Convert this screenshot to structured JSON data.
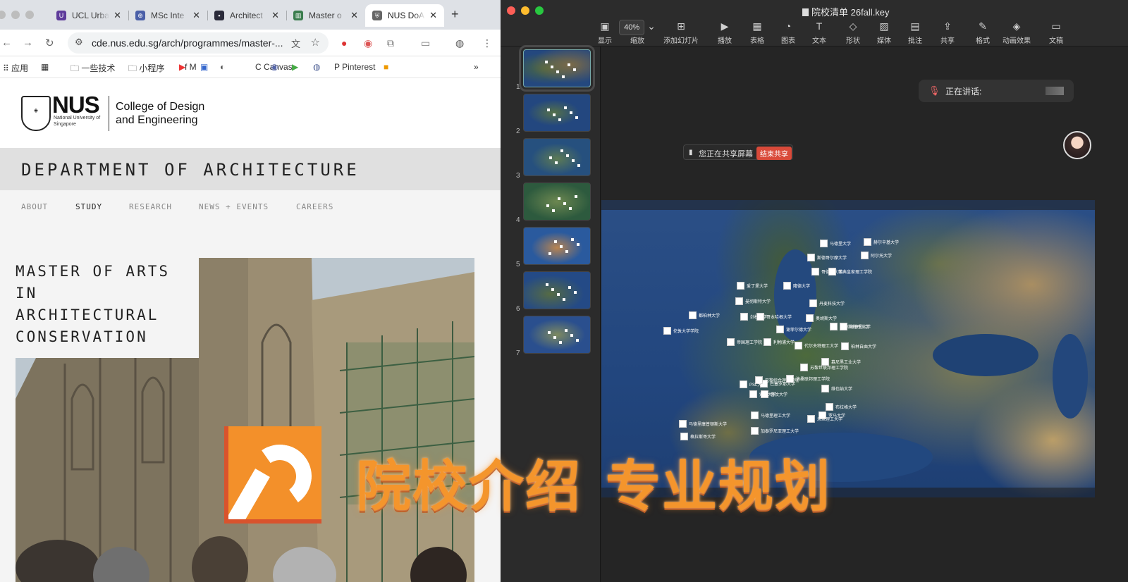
{
  "browser": {
    "tabs": [
      {
        "title": "UCL Urba",
        "color": "#5e3b9b",
        "glyph": "U"
      },
      {
        "title": "MSc Inte",
        "color": "#4a5fa8",
        "glyph": "⊕"
      },
      {
        "title": "Architect",
        "color": "#2a2a3a",
        "glyph": "▪"
      },
      {
        "title": "Master o",
        "color": "#3b7d4e",
        "glyph": "▥"
      },
      {
        "title": "NUS DoA",
        "color": "#666666",
        "glyph": "⛨"
      }
    ],
    "url": "cde.nus.edu.sg/arch/programmes/master-...",
    "bookmarks": [
      {
        "label": "应用",
        "icon": "⠿"
      },
      {
        "label": "",
        "icon": "▦"
      },
      {
        "label": "一些技术",
        "icon": "🗀"
      },
      {
        "label": "小程序",
        "icon": "🗀"
      },
      {
        "label": "M",
        "icon": "f"
      },
      {
        "label": "Canvas",
        "icon": "C"
      },
      {
        "label": "Pinterest",
        "icon": "P"
      }
    ]
  },
  "site": {
    "logo_word": "NUS",
    "logo_sub": "National University of Singapore",
    "college": "College of Design and Engineering",
    "department": "DEPARTMENT OF ARCHITECTURE",
    "nav": [
      "ABOUT",
      "STUDY",
      "RESEARCH",
      "NEWS + EVENTS",
      "CAREERS"
    ],
    "nav_active": "STUDY",
    "programme_title": [
      "MASTER OF ARTS",
      "IN",
      "ARCHITECTURAL",
      "CONSERVATION"
    ]
  },
  "keynote": {
    "doc_title": "院校清单 26fall.key",
    "zoom": "40%",
    "tools": [
      "显示",
      "缩放",
      "添加幻灯片",
      "播放",
      "表格",
      "图表",
      "文本",
      "形状",
      "媒体",
      "批注",
      "共享",
      "格式",
      "动画效果",
      "文稿"
    ],
    "slide_numbers": [
      "1",
      "2",
      "3",
      "4",
      "5",
      "6",
      "7"
    ],
    "speaking_label": "正在讲话:",
    "share_label": "您正在共享屏幕",
    "end_share": "结束共享",
    "map_labels": [
      "赫尔辛基大学",
      "阿尔托大学",
      "马德里大学",
      "斯德哥尔摩大学",
      "哥德堡大学",
      "瑞典皇家理工学院",
      "爱丁堡大学",
      "曼彻斯特大学",
      "隆德大学",
      "都柏林大学",
      "丹麦科技大学",
      "奥胡斯大学",
      "剑桥大学",
      "伦敦大学学院",
      "哥本哈根大学",
      "谢菲尔德大学",
      "利物浦大学",
      "帝国理工学院",
      "阿姆斯特丹大学",
      "代尔夫特理工大学",
      "柏林自由大学",
      "海德堡大学",
      "慕尼黑工业大学",
      "苏黎世联邦理工学院",
      "洛桑联邦理工学院",
      "维也纳大学",
      "布拉格大学",
      "米兰理工大学",
      "巴塞罗那大学",
      "巴黎综合理工学院",
      "马德里理工大学",
      "罗马大学",
      "马德里康普顿斯大学",
      "加泰罗尼亚理工大学",
      "格拉斯哥大学",
      "鲁汶大学",
      "索邦大学",
      "PSL大学"
    ],
    "banner_text": [
      "院校介绍",
      "专业规划"
    ]
  }
}
